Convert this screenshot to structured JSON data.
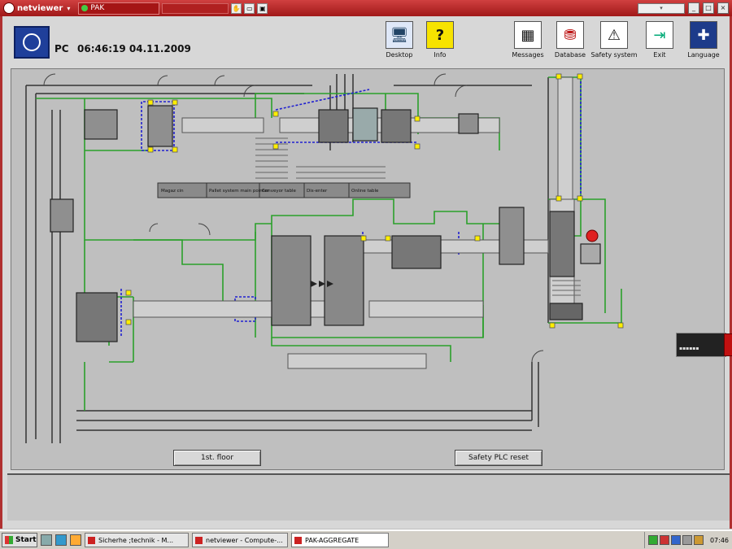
{
  "titlebar": {
    "app_name": "netviewer",
    "dropdown_arrow": "▾",
    "session_label": "PAK",
    "colors": {
      "title_bg": "#b82020"
    }
  },
  "header": {
    "pc_label": "PC",
    "datetime": "06:46:19  04.11.2009"
  },
  "toolbar": {
    "desktop": "Desktop",
    "info": "Info",
    "messages": "Messages",
    "database": "Database",
    "safety_system": "Safety system",
    "exit": "Exit",
    "language": "Language"
  },
  "plan": {
    "table_headers": [
      "Magaz cin",
      "Pallet system main pointer",
      "Conveyor table",
      "Dis-enter",
      "Online table"
    ],
    "colors": {
      "conveyor": "#2aa02a",
      "blue_link": "#2020d0",
      "sensor": "#ffff00",
      "alarm": "#e02020"
    }
  },
  "buttons": {
    "first_floor": "1st. floor",
    "safety_plc_reset": "Safety PLC reset"
  },
  "taskbar": {
    "start": "Start",
    "tasks": [
      {
        "label": "Sicherhe  ;technik - M..."
      },
      {
        "label": "netviewer - Compute-..."
      },
      {
        "label": "PAK-AGGREGATE"
      }
    ],
    "time": "07:46"
  }
}
